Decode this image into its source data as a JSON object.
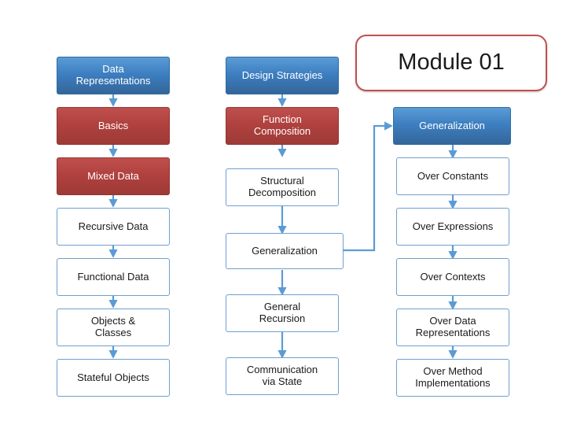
{
  "title_callout": {
    "text": "Module 01"
  },
  "columns": [
    {
      "name": "data-representations",
      "header": "Data\nRepresentations",
      "items": [
        {
          "label": "Basics",
          "style": "red"
        },
        {
          "label": "Mixed Data",
          "style": "red"
        },
        {
          "label": "Recursive Data",
          "style": "white"
        },
        {
          "label": "Functional Data",
          "style": "white"
        },
        {
          "label": "Objects &\nClasses",
          "style": "white"
        },
        {
          "label": "Stateful Objects",
          "style": "white"
        }
      ]
    },
    {
      "name": "design-strategies",
      "header": "Design Strategies",
      "items": [
        {
          "label": "Function\nComposition",
          "style": "red"
        },
        {
          "label": "Structural\nDecomposition",
          "style": "white"
        },
        {
          "label": "Generalization",
          "style": "white"
        },
        {
          "label": "General\nRecursion",
          "style": "white"
        },
        {
          "label": "Communication\nvia State",
          "style": "white"
        }
      ]
    },
    {
      "name": "generalization",
      "header": "Generalization",
      "items": [
        {
          "label": "Over Constants",
          "style": "white"
        },
        {
          "label": "Over Expressions",
          "style": "white"
        },
        {
          "label": "Over Contexts",
          "style": "white"
        },
        {
          "label": "Over Data\nRepresentations",
          "style": "white"
        },
        {
          "label": "Over Method\nImplementations",
          "style": "white"
        }
      ]
    }
  ],
  "colors": {
    "blue": "#4f81bd",
    "red": "#c0504d",
    "connector": "#5b9bd5",
    "white_border": "#6f9fd0"
  }
}
